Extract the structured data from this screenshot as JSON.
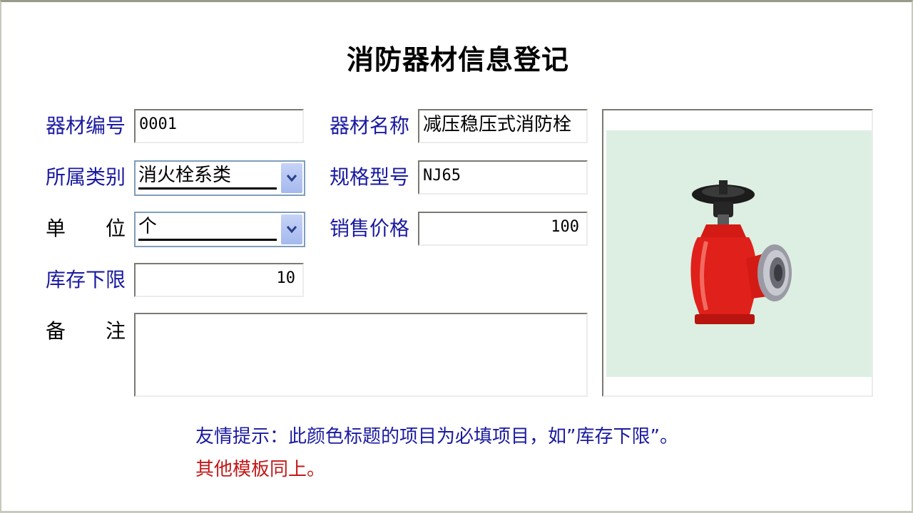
{
  "form": {
    "title": "消防器材信息登记",
    "fields": {
      "code": {
        "label": "器材编号",
        "value": "0001"
      },
      "name": {
        "label": "器材名称",
        "value": "减压稳压式消防栓"
      },
      "category": {
        "label": "所属类别",
        "value": "消火栓系类"
      },
      "spec": {
        "label": "规格型号",
        "value": "NJ65"
      },
      "unit": {
        "label_1": "单",
        "label_2": "位",
        "value": "个"
      },
      "price": {
        "label": "销售价格",
        "value": "100"
      },
      "min_stock": {
        "label": "库存下限",
        "value": "10"
      },
      "remark": {
        "label_1": "备",
        "label_2": "注",
        "value": ""
      }
    },
    "hint_line1": "友情提示：此颜色标题的项目为必填项目，如”库存下限”。",
    "hint_line2": "其他模板同上。"
  },
  "photo": {
    "subject": "fire-hydrant-valve"
  },
  "colors": {
    "required_label": "#1a1aa0",
    "normal_label": "#000000",
    "hint_red": "#c41818",
    "photo_background": "#dcefe2",
    "combo_button": "#b4c6f2",
    "valve_red": "#e0201a"
  }
}
